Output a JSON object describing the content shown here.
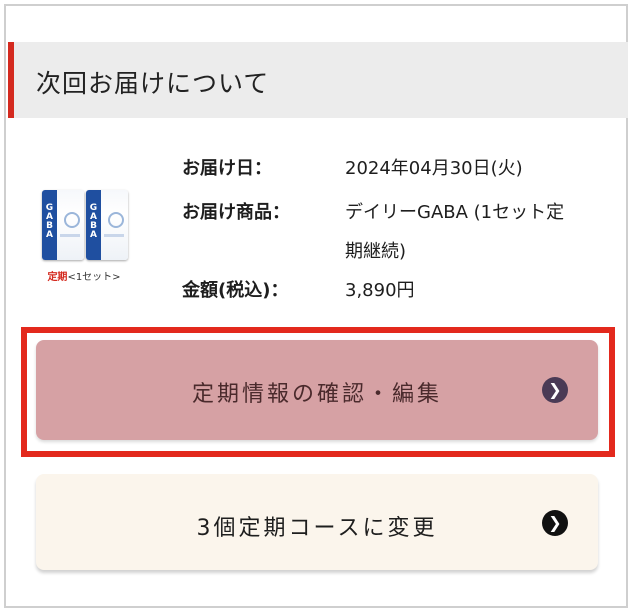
{
  "section": {
    "title": "次回お届けについて"
  },
  "product": {
    "pack_text": "GABA",
    "caption_prefix": "定期",
    "caption_suffix": "<1セット>"
  },
  "delivery": {
    "date_label": "お届け日：",
    "date_value": "2024年04月30日(火)",
    "item_label": "お届け商品：",
    "item_value_line1": "デイリーGABA (1セット定",
    "item_value_line2": "期継続)",
    "price_label": "金額(税込)：",
    "price_value": "3,890円"
  },
  "buttons": {
    "edit_label": "定期情報の確認・編集",
    "change_label": "3個定期コースに変更",
    "chevron_icon": "chevron-right-circle-icon"
  },
  "colors": {
    "accent_red": "#e3291d",
    "edit_button_bg": "#d6a1a4",
    "change_button_bg": "#fbf5ec"
  }
}
